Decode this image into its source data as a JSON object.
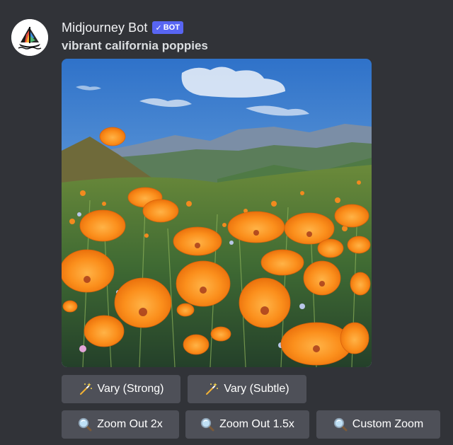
{
  "message": {
    "username": "Midjourney Bot",
    "badge": {
      "check": "✓",
      "label": "BOT",
      "color": "#5865f2"
    },
    "prompt": "vibrant california poppies",
    "avatar_icon": "sailboat-logo-icon",
    "image_icon": "generated-image-california-poppies"
  },
  "buttons": {
    "row1": [
      {
        "label": "Vary (Strong)",
        "icon": "sparkles-icon"
      },
      {
        "label": "Vary (Subtle)",
        "icon": "sparkles-icon"
      }
    ],
    "row2": [
      {
        "label": "Zoom Out 2x",
        "icon": "magnifier-icon"
      },
      {
        "label": "Zoom Out 1.5x",
        "icon": "magnifier-icon"
      },
      {
        "label": "Custom Zoom",
        "icon": "magnifier-icon"
      }
    ]
  },
  "colors": {
    "background": "#313338",
    "button": "#4e5058",
    "username": "#f2f3f5",
    "text": "#dbdee1"
  }
}
